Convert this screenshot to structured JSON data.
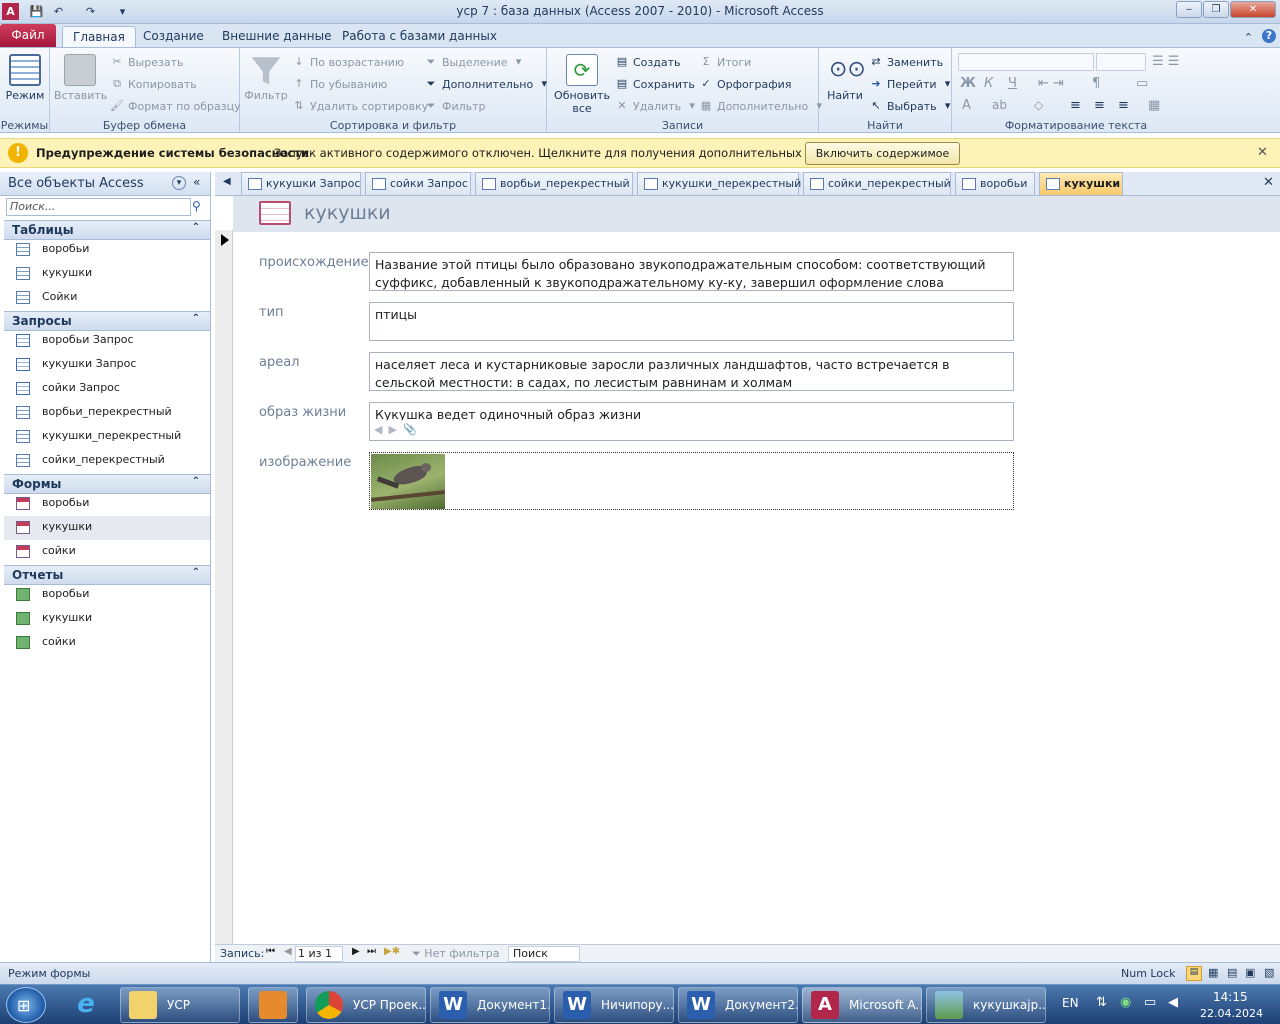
{
  "window": {
    "title": "уср 7 : база данных (Access 2007 - 2010)  -  Microsoft Access",
    "minimize": "‒",
    "restore": "❐",
    "close": "✕"
  },
  "ribbon_tabs": {
    "file": "Файл",
    "home": "Главная",
    "create": "Создание",
    "external": "Внешние данные",
    "dbtools": "Работа с базами данных"
  },
  "ribbon": {
    "views": {
      "mode": "Режим",
      "group": "Режимы"
    },
    "clipboard": {
      "paste": "Вставить",
      "cut": "Вырезать",
      "copy": "Копировать",
      "format": "Формат по образцу",
      "group": "Буфер обмена"
    },
    "sort": {
      "filter": "Фильтр",
      "asc": "По возрастанию",
      "desc": "По убыванию",
      "remove": "Удалить сортировку",
      "selection": "Выделение",
      "advanced": "Дополнительно",
      "toggle": "Фильтр",
      "group": "Сортировка и фильтр"
    },
    "records": {
      "refresh": "Обновить",
      "refresh2": "все",
      "new": "Создать",
      "save": "Сохранить",
      "delete": "Удалить",
      "totals": "Итоги",
      "spelling": "Орфография",
      "more": "Дополнительно",
      "group": "Записи"
    },
    "find": {
      "find": "Найти",
      "replace": "Заменить",
      "goto": "Перейти",
      "select": "Выбрать",
      "group": "Найти"
    },
    "text": {
      "group": "Форматирование текста"
    }
  },
  "security": {
    "title": "Предупреждение системы безопасности",
    "message": "Запуск активного содержимого отключен. Щелкните для получения дополнительных сведений.",
    "button": "Включить содержимое"
  },
  "nav": {
    "header": "Все объекты Access",
    "search_placeholder": "Поиск...",
    "tables": {
      "label": "Таблицы",
      "items": [
        "воробьи",
        "кукушки",
        "Сойки"
      ]
    },
    "queries": {
      "label": "Запросы",
      "items": [
        "воробьи Запрос",
        "кукушки Запрос",
        "сойки Запрос",
        "ворбьи_перекрестный",
        "кукушки_перекрестный",
        "сойки_перекрестный"
      ]
    },
    "forms": {
      "label": "Формы",
      "items": [
        "воробьи",
        "кукушки",
        "сойки"
      ]
    },
    "reports": {
      "label": "Отчеты",
      "items": [
        "воробьи",
        "кукушки",
        "сойки"
      ]
    }
  },
  "doc_tabs": [
    "кукушки Запрос",
    "сойки Запрос",
    "ворбьи_перекрестный",
    "кукушки_перекрестный",
    "сойки_перекрестный",
    "воробьи",
    "кукушки"
  ],
  "form": {
    "title": "кукушки",
    "fields": [
      {
        "label": "происхождение",
        "value": "Название этой птицы было образовано звукоподражательным способом: соответствующий суффикс, добавленный к звукоподражательному ку-ку, завершил оформление слова"
      },
      {
        "label": "тип",
        "value": "птицы"
      },
      {
        "label": "ареал",
        "value": "населяет леса и кустарниковые заросли различных ландшафтов, часто встречается в сельской местности: в садах, по лесистым равнинам и холмам"
      },
      {
        "label": "образ жизни",
        "value": "Кукушка ведет одиночный образ жизни"
      },
      {
        "label": "изображение",
        "value": ""
      }
    ]
  },
  "record_bar": {
    "label": "Запись:",
    "position": "1 из 1",
    "filter": "Нет фильтра",
    "search": "Поиск"
  },
  "status": {
    "mode": "Режим формы",
    "numlock": "Num Lock"
  },
  "taskbar": {
    "items": [
      "УСР",
      "УСР Проек...",
      "Документ1...",
      "Ничипору...",
      "Документ2...",
      "Microsoft A...",
      "кукушкаjp..."
    ],
    "lang": "EN",
    "time": "14:15",
    "date": "22.04.2024"
  }
}
